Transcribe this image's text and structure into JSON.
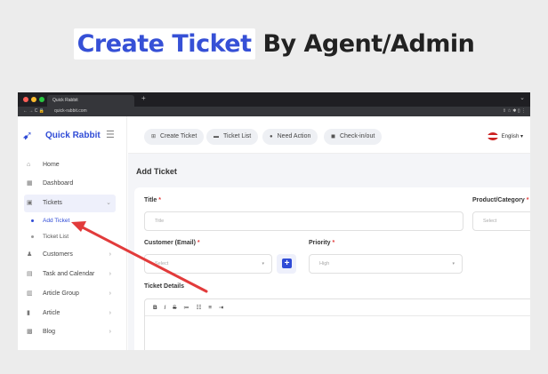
{
  "headline": {
    "highlight": "Create Ticket",
    "rest": "By Agent/Admin"
  },
  "browser": {
    "tab_title": "Quick Rabbit",
    "new_tab": "+",
    "url": "quick-rabbit.com",
    "nav": "← → C  🔒",
    "ext": "⇧  ☆  ✱  ▯  ⋮",
    "chevron": "⌄"
  },
  "sidebar": {
    "logo": "Quick Rabbit",
    "items": [
      {
        "label": "Home",
        "icon": "home-icon"
      },
      {
        "label": "Dashboard",
        "icon": "dashboard-icon"
      },
      {
        "label": "Tickets",
        "icon": "ticket-icon"
      },
      {
        "label": "Customers",
        "icon": "user-icon"
      },
      {
        "label": "Task and Calendar",
        "icon": "calendar-icon"
      },
      {
        "label": "Article Group",
        "icon": "folder-icon"
      },
      {
        "label": "Article",
        "icon": "bookmark-icon"
      },
      {
        "label": "Blog",
        "icon": "blog-icon"
      }
    ],
    "subitems": [
      {
        "label": "Add Ticket"
      },
      {
        "label": "Ticket List"
      }
    ]
  },
  "topnav": {
    "buttons": [
      {
        "label": "Create Ticket",
        "icon": "plus-square-icon"
      },
      {
        "label": "Ticket List",
        "icon": "list-icon"
      },
      {
        "label": "Need Action",
        "icon": "alert-icon"
      },
      {
        "label": "Check-in/out",
        "icon": "clock-icon"
      }
    ],
    "language": "English"
  },
  "form": {
    "page_title": "Add Ticket",
    "title_label": "Title",
    "title_placeholder": "Title",
    "product_label": "Product/Category",
    "product_value": "Select",
    "customer_label": "Customer (Email)",
    "customer_value": "Select",
    "priority_label": "Priority",
    "priority_value": "High",
    "details_label": "Ticket Details",
    "required_mark": "*",
    "toolbar": [
      "B",
      "I",
      "S",
      "≔",
      "☷",
      "≡",
      "⇥"
    ]
  },
  "colors": {
    "accent": "#2f4bd6",
    "arrow": "#e23b3b"
  }
}
